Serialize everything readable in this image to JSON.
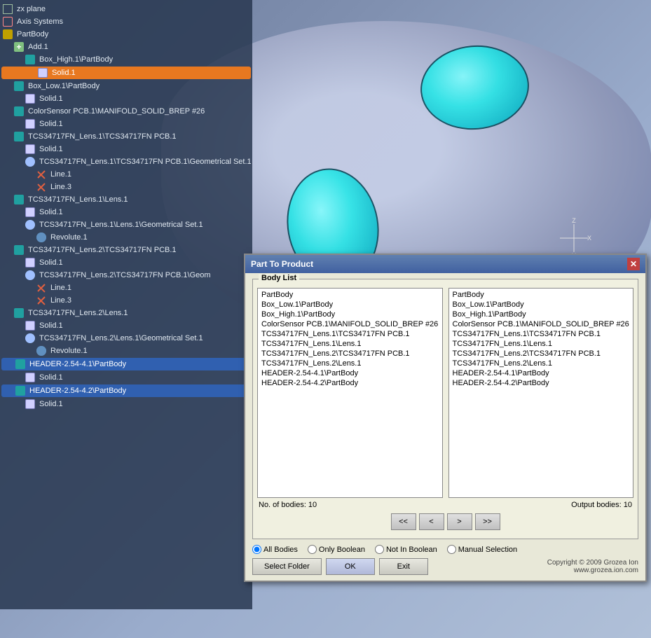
{
  "app": {
    "title": "Part To Product"
  },
  "tree": {
    "items": [
      {
        "id": "zx-plane",
        "label": "zx plane",
        "level": 0,
        "icon": "icon-plane",
        "expanded": false
      },
      {
        "id": "axis-systems",
        "label": "Axis Systems",
        "level": 0,
        "icon": "icon-axis",
        "expanded": false
      },
      {
        "id": "partbody",
        "label": "PartBody",
        "level": 0,
        "icon": "icon-body",
        "expanded": true
      },
      {
        "id": "add1",
        "label": "Add.1",
        "level": 1,
        "icon": "icon-add",
        "expanded": true
      },
      {
        "id": "box-high-partbody",
        "label": "Box_High.1\\PartBody",
        "level": 2,
        "icon": "icon-part",
        "expanded": true
      },
      {
        "id": "solid1-a",
        "label": "Solid.1",
        "level": 3,
        "icon": "icon-solid",
        "highlighted": true
      },
      {
        "id": "box-low-partbody",
        "label": "Box_Low.1\\PartBody",
        "level": 1,
        "icon": "icon-part",
        "expanded": true
      },
      {
        "id": "solid1-b",
        "label": "Solid.1",
        "level": 2,
        "icon": "icon-solid"
      },
      {
        "id": "colorsensor-pcb",
        "label": "ColorSensor PCB.1\\MANIFOLD_SOLID_BREP #26",
        "level": 1,
        "icon": "icon-part"
      },
      {
        "id": "solid1-c",
        "label": "Solid.1",
        "level": 2,
        "icon": "icon-solid"
      },
      {
        "id": "tcs-lens1-pcb1",
        "label": "TCS34717FN_Lens.1\\TCS34717FN PCB.1",
        "level": 1,
        "icon": "icon-part"
      },
      {
        "id": "solid1-d",
        "label": "Solid.1",
        "level": 2,
        "icon": "icon-solid"
      },
      {
        "id": "tcs-lens1-pcb1-geo",
        "label": "TCS34717FN_Lens.1\\TCS34717FN PCB.1\\Geometrical Set.1",
        "level": 2,
        "icon": "icon-geo"
      },
      {
        "id": "line1-a",
        "label": "Line.1",
        "level": 3,
        "icon": "icon-line"
      },
      {
        "id": "line3-a",
        "label": "Line.3",
        "level": 3,
        "icon": "icon-line"
      },
      {
        "id": "tcs-lens1-lens1",
        "label": "TCS34717FN_Lens.1\\Lens.1",
        "level": 1,
        "icon": "icon-part"
      },
      {
        "id": "solid1-e",
        "label": "Solid.1",
        "level": 2,
        "icon": "icon-solid"
      },
      {
        "id": "tcs-lens1-lens1-geo",
        "label": "TCS34717FN_Lens.1\\Lens.1\\Geometrical Set.1",
        "level": 2,
        "icon": "icon-geo"
      },
      {
        "id": "revolute1-a",
        "label": "Revolute.1",
        "level": 3,
        "icon": "icon-revolute"
      },
      {
        "id": "tcs-lens2-pcb1",
        "label": "TCS34717FN_Lens.2\\TCS34717FN PCB.1",
        "level": 1,
        "icon": "icon-part"
      },
      {
        "id": "solid1-f",
        "label": "Solid.1",
        "level": 2,
        "icon": "icon-solid"
      },
      {
        "id": "tcs-lens2-pcb1-geo",
        "label": "TCS34717FN_Lens.2\\TCS34717FN PCB.1\\Geom",
        "level": 2,
        "icon": "icon-geo"
      },
      {
        "id": "line1-b",
        "label": "Line.1",
        "level": 3,
        "icon": "icon-line"
      },
      {
        "id": "line3-b",
        "label": "Line.3",
        "level": 3,
        "icon": "icon-line"
      },
      {
        "id": "tcs-lens2-lens1",
        "label": "TCS34717FN_Lens.2\\Lens.1",
        "level": 1,
        "icon": "icon-part"
      },
      {
        "id": "solid1-g",
        "label": "Solid.1",
        "level": 2,
        "icon": "icon-solid"
      },
      {
        "id": "tcs-lens2-lens1-geo",
        "label": "TCS34717FN_Lens.2\\Lens.1\\Geometrical Set.1",
        "level": 2,
        "icon": "icon-geo"
      },
      {
        "id": "revolute1-b",
        "label": "Revolute.1",
        "level": 3,
        "icon": "icon-revolute"
      },
      {
        "id": "header-4-1",
        "label": "HEADER-2.54-4.1\\PartBody",
        "level": 1,
        "icon": "icon-part",
        "highlighted2": true
      },
      {
        "id": "solid1-h",
        "label": "Solid.1",
        "level": 2,
        "icon": "icon-solid"
      },
      {
        "id": "header-4-2",
        "label": "HEADER-2.54-4.2\\PartBody",
        "level": 1,
        "icon": "icon-part",
        "highlighted2": true
      },
      {
        "id": "solid1-i",
        "label": "Solid.1",
        "level": 2,
        "icon": "icon-solid"
      }
    ]
  },
  "dialog": {
    "title": "Part To Product",
    "close_label": "✕",
    "body_list_group_label": "Body List",
    "left_list": {
      "items": [
        "PartBody",
        "Box_Low.1\\PartBody",
        "Box_High.1\\PartBody",
        "ColorSensor PCB.1\\MANIFOLD_SOLID_BREP #26",
        "TCS34717FN_Lens.1\\TCS34717FN PCB.1",
        "TCS34717FN_Lens.1\\Lens.1",
        "TCS34717FN_Lens.2\\TCS34717FN PCB.1",
        "TCS34717FN_Lens.2\\Lens.1",
        "HEADER-2.54-4.1\\PartBody",
        "HEADER-2.54-4.2\\PartBody"
      ]
    },
    "right_list": {
      "items": [
        "PartBody",
        "Box_Low.1\\PartBody",
        "Box_High.1\\PartBody",
        "ColorSensor PCB.1\\MANIFOLD_SOLID_BREP #26",
        "TCS34717FN_Lens.1\\TCS34717FN PCB.1",
        "TCS34717FN_Lens.1\\Lens.1",
        "TCS34717FN_Lens.2\\TCS34717FN PCB.1",
        "TCS34717FN_Lens.2\\Lens.1",
        "HEADER-2.54-4.1\\PartBody",
        "HEADER-2.54-4.2\\PartBody"
      ]
    },
    "no_of_bodies_label": "No. of bodies: 10",
    "output_bodies_label": "Output bodies: 10",
    "nav": {
      "first": "<<",
      "prev": "<",
      "next": ">",
      "last": ">>"
    },
    "radio_options": [
      {
        "id": "all-bodies",
        "label": "All Bodies",
        "checked": true
      },
      {
        "id": "only-boolean",
        "label": "Only Boolean",
        "checked": false
      },
      {
        "id": "not-in-boolean",
        "label": "Not In Boolean",
        "checked": false
      },
      {
        "id": "manual-selection",
        "label": "Manual Selection",
        "checked": false
      }
    ],
    "buttons": {
      "select_folder": "Select Folder",
      "ok": "OK",
      "exit": "Exit"
    },
    "copyright": "Copyright © 2009 Grozea Ion\nwww.grozea.ion.com"
  }
}
